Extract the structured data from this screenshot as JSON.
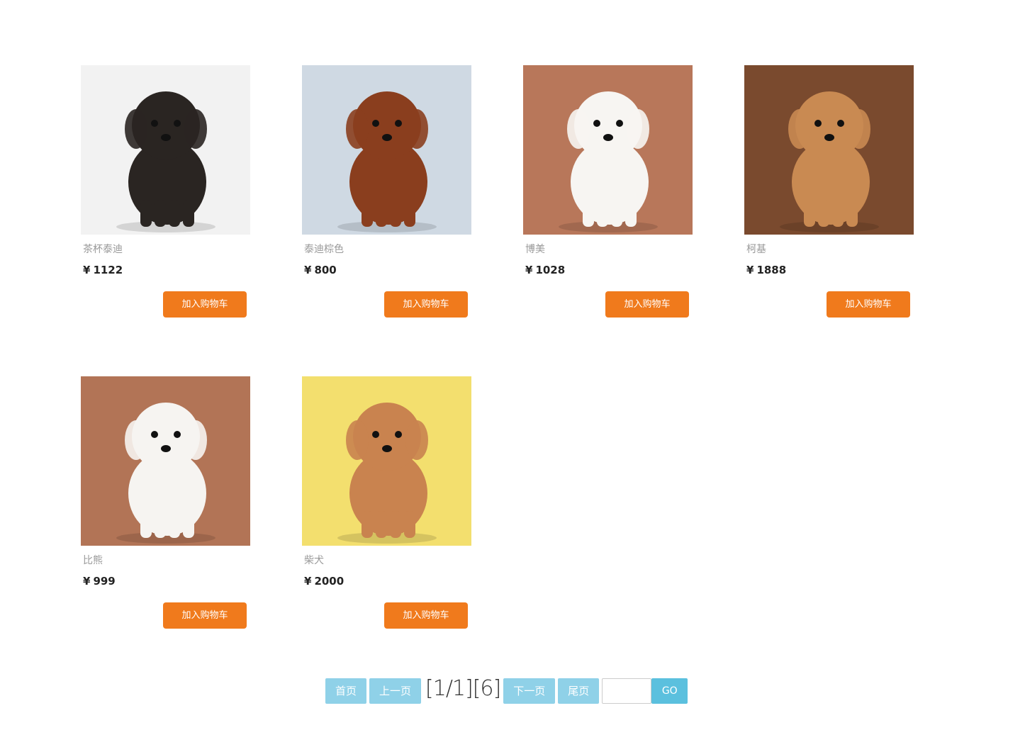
{
  "products": [
    {
      "name": "茶杯泰迪",
      "currency": "¥",
      "price": "1122",
      "button": "加入购物车",
      "image": "black-toy-poodle-photo",
      "bg": "#f2f2f2",
      "dog": "#2a2522"
    },
    {
      "name": "泰迪棕色",
      "currency": "¥",
      "price": "800",
      "button": "加入购物车",
      "image": "brown-poodle-photo",
      "bg": "#cfd9e3",
      "dog": "#8a3e1e"
    },
    {
      "name": "博美",
      "currency": "¥",
      "price": "1028",
      "button": "加入购物车",
      "image": "white-pomeranian-photo",
      "bg": "#b8775a",
      "dog": "#f7f5f2"
    },
    {
      "name": "柯基",
      "currency": "¥",
      "price": "1888",
      "button": "加入购物车",
      "image": "corgi-photo",
      "bg": "#7a4a2e",
      "dog": "#c98a52"
    },
    {
      "name": "比熊",
      "currency": "¥",
      "price": "999",
      "button": "加入购物车",
      "image": "white-bichon-photo",
      "bg": "#b27456",
      "dog": "#f6f4f1"
    },
    {
      "name": "柴犬",
      "currency": "¥",
      "price": "2000",
      "button": "加入购物车",
      "image": "shiba-inu-photo",
      "bg": "#f3df6e",
      "dog": "#c9834f"
    }
  ],
  "pagination": {
    "first": "首页",
    "prev": "上一页",
    "info": "[1/1][6]",
    "next": "下一页",
    "last": "尾页",
    "input_value": "",
    "go": "GO"
  },
  "colors": {
    "cart_button": "#f07a1c",
    "pager_button": "#8fd1e8",
    "go_button": "#5bc0de"
  }
}
